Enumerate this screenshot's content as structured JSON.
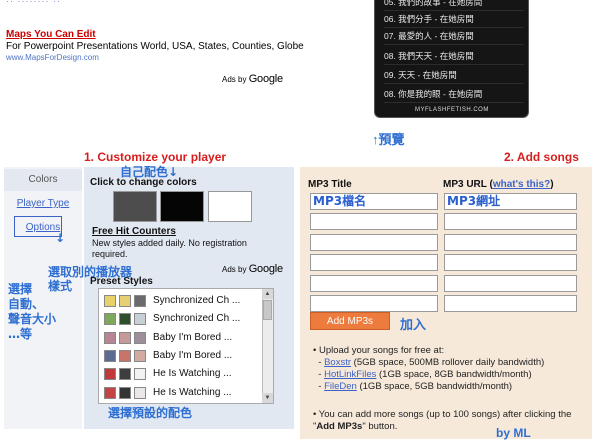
{
  "top_ad": {
    "dots": "·· ········ ··",
    "title": "Maps You Can Edit",
    "description": "For Powerpoint Presentations World, USA, States, Counties, Globe",
    "url": "www.MapsForDesign.com",
    "ads_by": "Ads by",
    "google": "Google"
  },
  "playlist": {
    "rows": [
      "05. 我們的故事 - 在她房間",
      "06. 我們分手 - 在她房間",
      "07. 最愛的人 - 在她房間",
      "08. 我們天天 - 在她房間",
      "09. 天天 - 在她房間",
      "08. 你是我的眼 - 在她房間"
    ],
    "brand": "MYFLASHFETISH.COM"
  },
  "annotations": {
    "preview": "↑預覽",
    "own_color": "自己配色↓",
    "choose_player": "選取別的播放器\n樣式",
    "options_desc": "選擇\n自動、\n聲音大小\n…等",
    "preset_desc": "選擇預設的配色",
    "add": "加入",
    "options_arrow": "↓",
    "mp3_name": "MP3檔名",
    "mp3_url": "MP3網址",
    "signature": "by ML"
  },
  "steps": {
    "customize": "1. Customize your player",
    "add_songs": "2. Add songs"
  },
  "tabs": {
    "colors": "Colors",
    "player_type": "Player Type",
    "options": "Options"
  },
  "customize": {
    "click_change": "Click to change colors",
    "swatches": [
      "#4d4d4d",
      "#050505",
      "#ffffff"
    ],
    "free_hit_counters": "Free Hit Counters",
    "counters_desc": "New styles added daily. No registration required.",
    "ads_by": "Ads by",
    "google": "Google",
    "preset_title": "Preset Styles",
    "presets": [
      {
        "colors": [
          "#e7d26a",
          "#e6cf74",
          "#6b6b6b"
        ],
        "name": "Synchronized Ch ..."
      },
      {
        "colors": [
          "#7fa95a",
          "#2d4f2b",
          "#c9cfd7"
        ],
        "name": "Synchronized Ch ..."
      },
      {
        "colors": [
          "#b98494",
          "#c79a9a",
          "#9e8e9b"
        ],
        "name": "Baby I'm Bored ..."
      },
      {
        "colors": [
          "#5d6b92",
          "#c9746b",
          "#d3aaa0"
        ],
        "name": "Baby I'm Bored ..."
      },
      {
        "colors": [
          "#c03a39",
          "#3e3e3e",
          "#f2f2f2"
        ],
        "name": "He Is Watching ..."
      },
      {
        "colors": [
          "#c24445",
          "#343434",
          "#ece7e7"
        ],
        "name": "He Is Watching ..."
      }
    ]
  },
  "songs": {
    "title_header": "MP3 Title",
    "url_header": "MP3 URL",
    "whats_this": "what's this?",
    "add_button": "Add MP3s",
    "upload_intro": "• Upload your songs for free at:",
    "hosts": [
      {
        "name": "Boxstr",
        "desc": " (5GB space, 500MB rollover daily bandwidth)"
      },
      {
        "name": "HotLinkFiles",
        "desc": " (1GB space, 8GB bandwidth/month)"
      },
      {
        "name": "FileDen",
        "desc": " (1GB space, 5GB bandwidth/month)"
      }
    ],
    "more_prefix": "• You can add more songs (up to 100 songs) after clicking the \"",
    "more_bold": "Add MP3s",
    "more_suffix": "\" button."
  },
  "colors": {
    "step_heading": "#d61e1e",
    "annotation": "#2f6fd2",
    "link": "#3b63c7",
    "add_button": "#ed7b3e",
    "left_panel": "#e1e8f2",
    "right_panel": "#f7e9da"
  }
}
